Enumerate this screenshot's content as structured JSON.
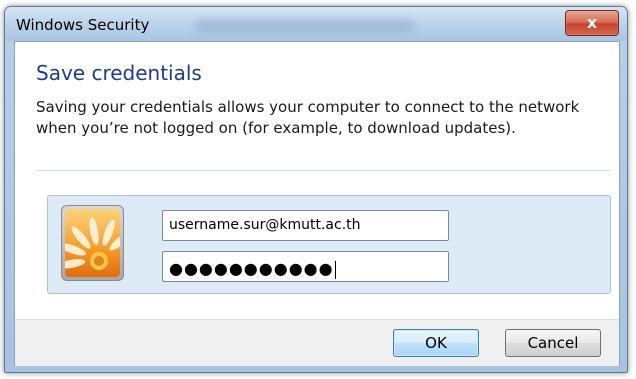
{
  "window": {
    "title": "Windows Security",
    "close_glyph": "x"
  },
  "dialog": {
    "heading": "Save credentials",
    "description": "Saving your credentials allows your computer to connect to the network when you’re not logged on (for example, to download updates)."
  },
  "credentials": {
    "username_value": "username.sur@kmutt.ac.th",
    "password_display": "●●●●●●●●●●●",
    "avatar_icon": "user-flower-avatar"
  },
  "buttons": {
    "ok_label": "OK",
    "cancel_label": "Cancel"
  },
  "colors": {
    "heading": "#1e3b8f",
    "close_button": "#c3442b",
    "panel_background": "#dfeaf7"
  }
}
